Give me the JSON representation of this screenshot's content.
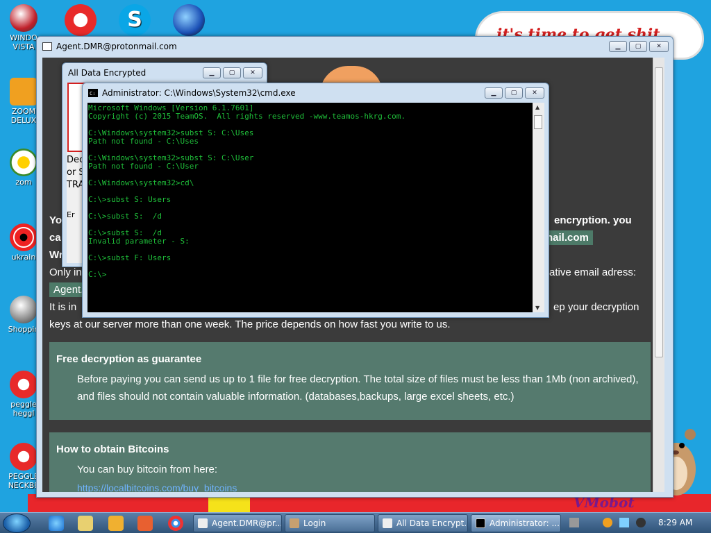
{
  "desktop": {
    "cloud_text": "it's time to get shit",
    "vmobot_text": "VMobot",
    "icons": [
      {
        "label": "WINDOWS VISTA",
        "line1": "WINDO",
        "line2": "VISTA"
      },
      {
        "label": "ZOOMA DELUXE",
        "line1": "ZOOM",
        "line2": "DELUX"
      },
      {
        "label": "zombie",
        "line1": "zom",
        "line2": ""
      },
      {
        "label": "ukraine",
        "line1": "ukrain",
        "line2": ""
      },
      {
        "label": "Shopping",
        "line1": "Shoppin",
        "line2": ""
      },
      {
        "label": "peggle heggle",
        "line1": "peggle",
        "line2": "heggl"
      },
      {
        "label": "PEGGLE NECKBEARD",
        "line1": "PEGGLE",
        "line2": "NECKBE"
      }
    ],
    "colors": {
      "background": "#1fa3e0",
      "stripe_red": "#e8262b"
    }
  },
  "main_window": {
    "title": "Agent.DMR@protonmail.com",
    "fragments": {
      "yo": "Yo",
      "encryption": "encryption. you",
      "ca": "ca",
      "email_tail": "nail.com",
      "wr": "Wr",
      "only_in": "Only in",
      "alt_email": "ative email adress:",
      "agent_chip": "Agent.",
      "it_is_in": "It is in",
      "keep_keys": "ep your decryption",
      "keys_line": "keys at our server more than one week. The price depends on how fast you write to us."
    },
    "panel_free": {
      "heading": "Free decryption as guarantee",
      "body": "Before paying you can send us up to 1 file for free decryption. The total size of files must be less than 1Mb (non archived), and files should not contain valuable information. (databases,backups, large excel sheets, etc.)"
    },
    "panel_bitcoin": {
      "heading": "How to obtain Bitcoins",
      "body": "You can buy bitcoin from here:",
      "link": "https://localbitcoins.com/buy_bitcoins"
    },
    "colors": {
      "body_bg": "#3b3b3b",
      "panel": "#557a6e"
    }
  },
  "ade_window": {
    "title": "All Data Encrypted",
    "frag1": "Dec",
    "frag2": "or S",
    "frag3": "TRA",
    "frag4": "Er"
  },
  "cmd_window": {
    "title": "Administrator: C:\\Windows\\System32\\cmd.exe",
    "lines": "Microsoft Windows [Version 6.1.7601]\nCopyright (c) 2015 TeamOS.  All rights reserved -www.teamos-hkrg.com.\n\nC:\\Windows\\system32>subst S: C:\\Uses\nPath not found - C:\\Uses\n\nC:\\Windows\\system32>subst S: C:\\User\nPath not found - C:\\User\n\nC:\\Windows\\system32>cd\\\n\nC:\\>subst S: Users\n\nC:\\>subst S:  /d\n\nC:\\>subst S:  /d\nInvalid parameter - S:\n\nC:\\>subst F: Users\n\nC:\\>",
    "text_color": "#1fbf3a"
  },
  "taskbar": {
    "tasks": [
      {
        "label": "Agent.DMR@pr..."
      },
      {
        "label": "Login"
      },
      {
        "label": "All Data Encrypt..."
      },
      {
        "label": "Administrator: ..."
      }
    ],
    "clock": "8:29 AM"
  }
}
